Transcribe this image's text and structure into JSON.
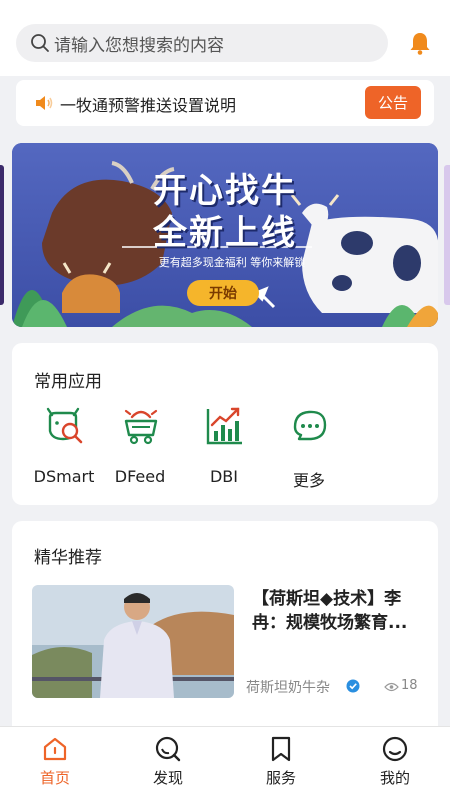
{
  "search": {
    "placeholder": "请输入您想搜索的内容"
  },
  "notice": {
    "text": "一牧通预警推送设置说明",
    "button": "公告"
  },
  "banner": {
    "title_line1": "开心找牛",
    "title_line2": "全新上线",
    "subtitle": "更有超多现金福利 等你来解锁",
    "start_button": "开始"
  },
  "apps": {
    "title": "常用应用",
    "items": [
      {
        "label": "DSmart",
        "icon": "cow-search-icon"
      },
      {
        "label": "DFeed",
        "icon": "feed-cart-icon"
      },
      {
        "label": "DBI",
        "icon": "bar-chart-icon"
      },
      {
        "label": "更多",
        "icon": "more-chat-icon"
      }
    ]
  },
  "recommend": {
    "title": "精华推荐",
    "article": {
      "title": "【荷斯坦◆技术】李冉：规模牧场繁育...",
      "source": "荷斯坦奶牛杂",
      "views": "18"
    }
  },
  "tabbar": {
    "items": [
      {
        "label": "首页",
        "icon": "home-icon",
        "active": true
      },
      {
        "label": "发现",
        "icon": "discover-icon",
        "active": false
      },
      {
        "label": "服务",
        "icon": "bookmark-icon",
        "active": false
      },
      {
        "label": "我的",
        "icon": "profile-icon",
        "active": false
      }
    ]
  },
  "colors": {
    "accent": "#ee6428",
    "app_icon_green": "#1f8a4c",
    "app_icon_red": "#d9452b",
    "banner_bg": "#3d4fa6",
    "start_button": "#f5b52b"
  }
}
